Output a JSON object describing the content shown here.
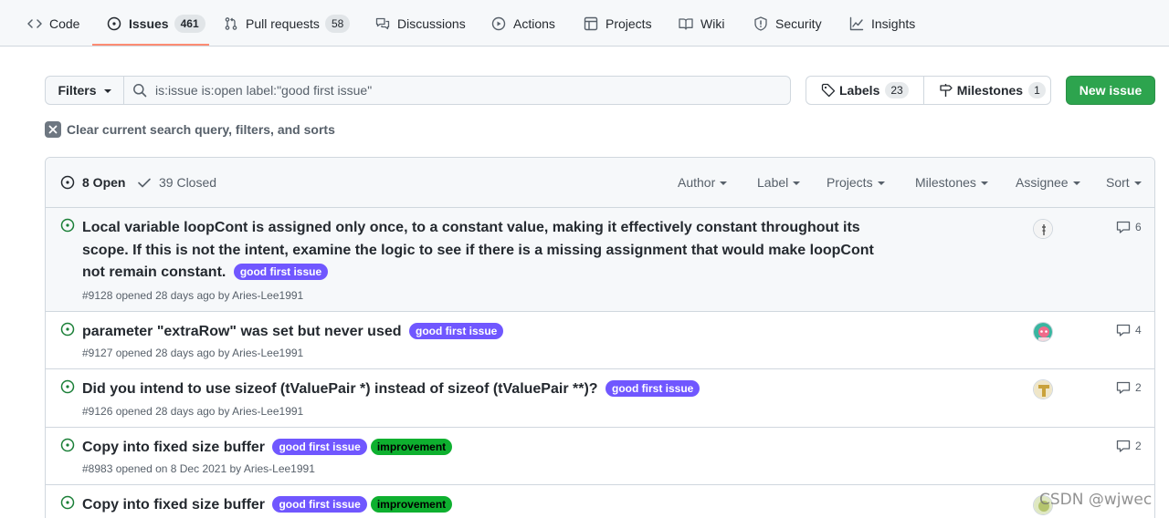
{
  "nav": {
    "tabs": [
      {
        "label": "Code",
        "icon": "code-icon"
      },
      {
        "label": "Issues",
        "count": "461",
        "icon": "issue-opened-icon",
        "selected": true
      },
      {
        "label": "Pull requests",
        "count": "58",
        "icon": "git-pull-request-icon"
      },
      {
        "label": "Discussions",
        "icon": "comment-discussion-icon"
      },
      {
        "label": "Actions",
        "icon": "play-icon"
      },
      {
        "label": "Projects",
        "icon": "table-icon"
      },
      {
        "label": "Wiki",
        "icon": "book-icon"
      },
      {
        "label": "Security",
        "icon": "shield-icon"
      },
      {
        "label": "Insights",
        "icon": "graph-icon"
      }
    ],
    "underline_color": "#fd8c73"
  },
  "filters": {
    "button_label": "Filters",
    "search_value": "is:issue is:open label:\"good first issue\""
  },
  "labels_btn": {
    "label": "Labels",
    "count": "23"
  },
  "milestones_btn": {
    "label": "Milestones",
    "count": "1"
  },
  "new_issue_label": "New issue",
  "clear_query_label": "Clear current search query, filters, and sorts",
  "header": {
    "open_label": "8 Open",
    "closed_label": "39 Closed",
    "filters": [
      "Author",
      "Label",
      "Projects",
      "Milestones",
      "Assignee",
      "Sort"
    ]
  },
  "issues": [
    {
      "title": "Local variable loopCont is assigned only once, to a constant value, making it effectively constant throughout its scope. If this is not the intent, examine the logic to see if there is a missing assignment that would make loopCont not remain constant.",
      "labels": [
        "good first issue"
      ],
      "meta_prefix": "#9128 opened 28 days ago by ",
      "author": "Aries-Lee1991",
      "comments": "6"
    },
    {
      "title": "parameter \"extraRow\" was set but never used",
      "labels": [
        "good first issue"
      ],
      "meta_prefix": "#9127 opened 28 days ago by ",
      "author": "Aries-Lee1991",
      "comments": "4"
    },
    {
      "title": "Did you intend to use sizeof (tValuePair *) instead of sizeof (tValuePair **)?",
      "labels": [
        "good first issue"
      ],
      "meta_prefix": "#9126 opened 28 days ago by ",
      "author": "Aries-Lee1991",
      "comments": "2"
    },
    {
      "title": "Copy into fixed size buffer",
      "labels": [
        "good first issue",
        "improvement"
      ],
      "meta_prefix": "#8983 opened on 8 Dec 2021 by ",
      "author": "Aries-Lee1991",
      "comments": "2"
    },
    {
      "title": "Copy into fixed size buffer",
      "labels": [
        "good first issue",
        "improvement"
      ],
      "meta_prefix": "",
      "author": "",
      "comments": ""
    }
  ],
  "colors": {
    "open_green": "#1a7f37",
    "primary_button": "#2da44e",
    "label_good_first_issue": "#7057ff",
    "label_improvement": "#0eb02f"
  },
  "watermark": "CSDN @wjwec"
}
